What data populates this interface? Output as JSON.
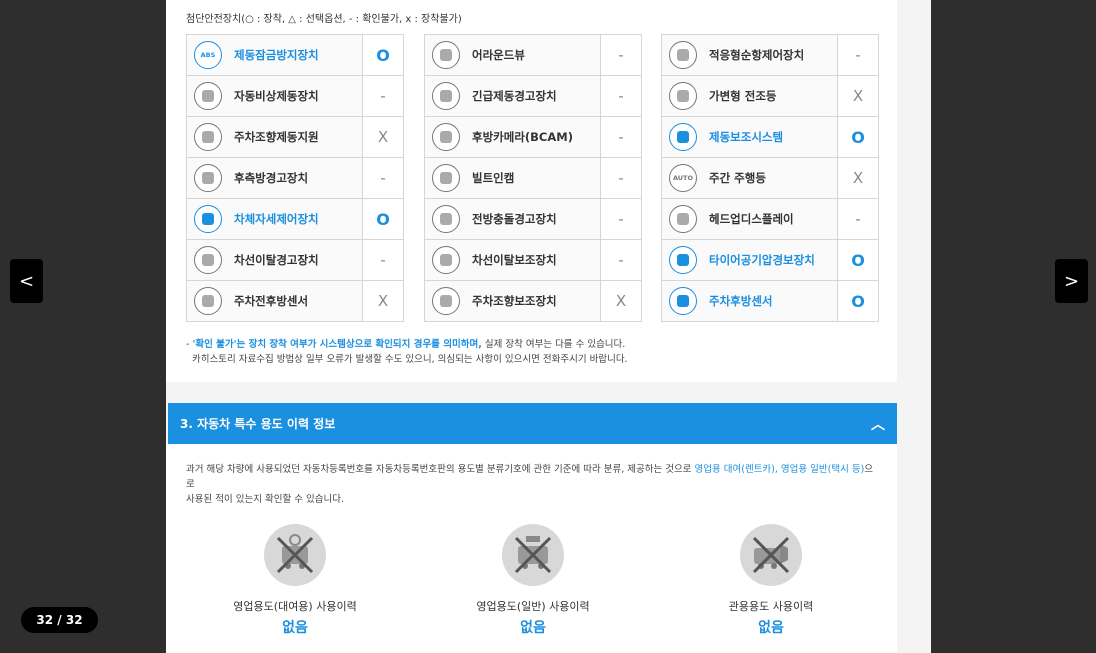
{
  "legend": "첨단안전장치(○ : 장착, △ : 선택옵션, - : 확인불가, x : 장착불가)",
  "columns": [
    [
      {
        "name": "제동잠금방지장치",
        "status": "O",
        "icon": "abs-icon",
        "highlight": true,
        "badge": "ABS"
      },
      {
        "name": "자동비상제동장치",
        "status": "-",
        "icon": "emergency-brake-icon",
        "highlight": false
      },
      {
        "name": "주차조향제동지원",
        "status": "X",
        "icon": "parking-steer-icon",
        "highlight": false
      },
      {
        "name": "후측방경고장치",
        "status": "-",
        "icon": "rear-side-warning-icon",
        "highlight": false
      },
      {
        "name": "차체자세제어장치",
        "status": "O",
        "icon": "stability-control-icon",
        "highlight": true
      },
      {
        "name": "차선이탈경고장치",
        "status": "-",
        "icon": "lane-departure-warning-icon",
        "highlight": false
      },
      {
        "name": "주차전후방센서",
        "status": "X",
        "icon": "parking-sensor-icon",
        "highlight": false
      }
    ],
    [
      {
        "name": "어라운드뷰",
        "status": "-",
        "icon": "around-view-icon",
        "highlight": false
      },
      {
        "name": "긴급제동경고장치",
        "status": "-",
        "icon": "emergency-warning-icon",
        "highlight": false
      },
      {
        "name": "후방카메라(BCAM)",
        "status": "-",
        "icon": "rear-camera-icon",
        "highlight": false
      },
      {
        "name": "빌트인캠",
        "status": "-",
        "icon": "builtin-cam-icon",
        "highlight": false
      },
      {
        "name": "전방충돌경고장치",
        "status": "-",
        "icon": "forward-collision-icon",
        "highlight": false
      },
      {
        "name": "차선이탈보조장치",
        "status": "-",
        "icon": "lane-assist-icon",
        "highlight": false
      },
      {
        "name": "주차조향보조장치",
        "status": "X",
        "icon": "parking-assist-icon",
        "highlight": false
      }
    ],
    [
      {
        "name": "적응형순항제어장치",
        "status": "-",
        "icon": "adaptive-cruise-icon",
        "highlight": false
      },
      {
        "name": "가변형 전조등",
        "status": "X",
        "icon": "headlamp-icon",
        "highlight": false
      },
      {
        "name": "제동보조시스템",
        "status": "O",
        "icon": "brake-assist-icon",
        "highlight": true
      },
      {
        "name": "주간 주행등",
        "status": "X",
        "icon": "daytime-light-icon",
        "highlight": false,
        "badge": "AUTO"
      },
      {
        "name": "헤드업디스플레이",
        "status": "-",
        "icon": "hud-icon",
        "highlight": false
      },
      {
        "name": "타이어공기압경보장치",
        "status": "O",
        "icon": "tire-pressure-icon",
        "highlight": true
      },
      {
        "name": "주차후방센서",
        "status": "O",
        "icon": "rear-sensor-icon",
        "highlight": true
      }
    ]
  ],
  "note": {
    "line1_prefix": "- ",
    "line1_highlight": "'확인 불가'는 장치 장착 여부가 시스템상으로 확인되지 경우를 의미하며,",
    "line1_rest": " 실제 장착 여부는 다를 수 있습니다.",
    "line2": "카히스토리 자료수집 방법상 일부 오류가 발생할 수도 있으니, 의심되는 사항이 있으시면 전화주시기 바랍니다."
  },
  "section": {
    "title": "3. 자동차 특수 용도 이력 정보",
    "chevron": "︿"
  },
  "description": {
    "part1": "과거 해당 차량에 사용되었던 자동차등록번호를 자동차등록번호판의 용도별 분류기호에 관한 기준에 따라 분류, 제공하는 것으로 ",
    "highlight": "영업용 대여(렌트카), 영업용 일반(택시 등)",
    "part2": "으로",
    "line2": "사용된 적이 있는지 확인할 수 있습니다."
  },
  "usages": [
    {
      "label": "영업용도(대여용) 사용이력",
      "value": "없음",
      "icon": "rental-car-crossed-icon"
    },
    {
      "label": "영업용도(일반) 사용이력",
      "value": "없음",
      "icon": "taxi-crossed-icon"
    },
    {
      "label": "관용용도 사용이력",
      "value": "없음",
      "icon": "government-car-crossed-icon"
    }
  ],
  "nav": {
    "prev": "<",
    "next": ">"
  },
  "pager": "32 / 32"
}
